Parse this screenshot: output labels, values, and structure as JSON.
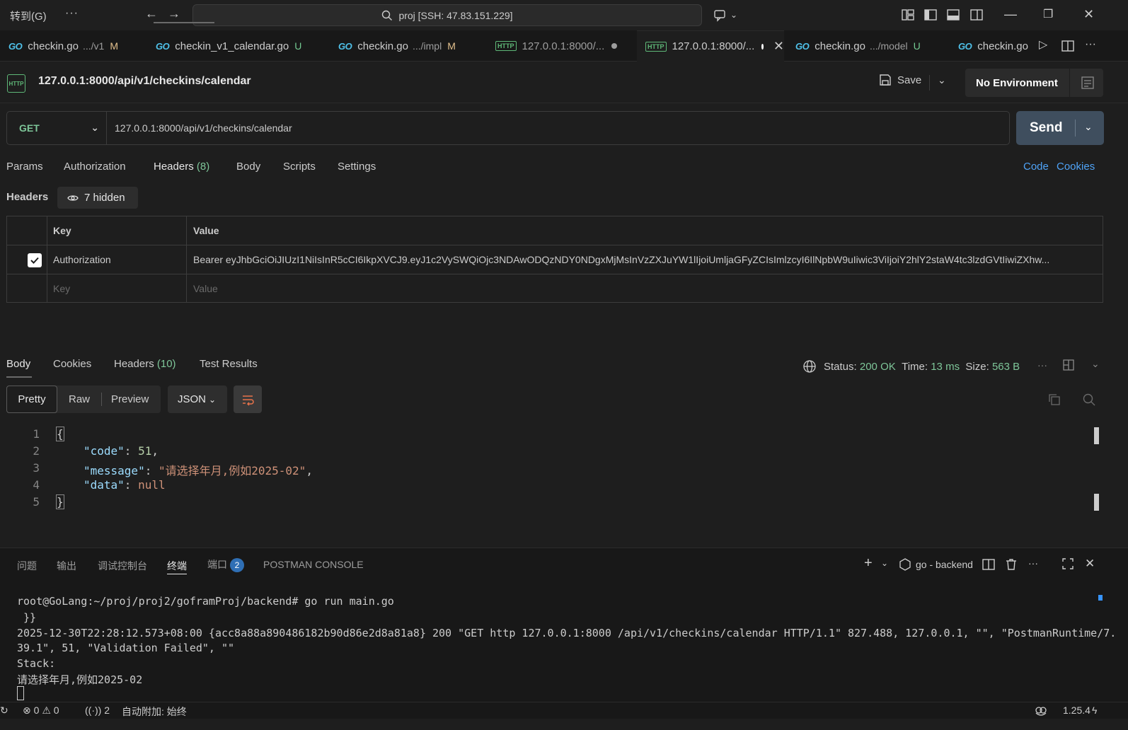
{
  "titlebar": {
    "goto_menu": "转到(G)",
    "more": "···",
    "search_text": "proj [SSH: 47.83.151.229]"
  },
  "tabs": [
    {
      "label": "checkin.go",
      "sub": ".../v1",
      "status": "M"
    },
    {
      "label": "checkin_v1_calendar.go",
      "sub": "",
      "status": "U"
    },
    {
      "label": "checkin.go",
      "sub": ".../impl",
      "status": "M"
    },
    {
      "label": "127.0.0.1:8000/...",
      "sub": "",
      "status": ""
    },
    {
      "label": "127.0.0.1:8000/...",
      "sub": "",
      "status": ""
    },
    {
      "label": "checkin.go",
      "sub": ".../model",
      "status": "U"
    },
    {
      "label": "checkin.go",
      "sub": "",
      "status": ""
    }
  ],
  "request": {
    "title": "127.0.0.1:8000/api/v1/checkins/calendar",
    "save_label": "Save",
    "environment": "No Environment",
    "method": "GET",
    "url": "127.0.0.1:8000/api/v1/checkins/calendar",
    "send_label": "Send"
  },
  "request_tabs": {
    "params": "Params",
    "authorization": "Authorization",
    "headers": "Headers",
    "headers_count": "(8)",
    "body": "Body",
    "scripts": "Scripts",
    "settings": "Settings",
    "code_link": "Code",
    "cookies_link": "Cookies"
  },
  "headers_section": {
    "label": "Headers",
    "hidden_label": "7 hidden",
    "col_key": "Key",
    "col_value": "Value",
    "rows": [
      {
        "key": "Authorization",
        "value": "Bearer eyJhbGciOiJIUzI1NiIsInR5cCI6IkpXVCJ9.eyJ1c2VySWQiOjc3NDAwODQzNDY0NDgxMjMsInVzZXJuYW1lIjoiUmljaGFyZCIsImlzcyI6IlNpbW9uIiwic3ViIjoiY2hlY2staW4tc3lzdGVtIiwiZXhw..."
      }
    ],
    "key_placeholder": "Key",
    "value_placeholder": "Value"
  },
  "response": {
    "tabs": {
      "body": "Body",
      "cookies": "Cookies",
      "headers": "Headers",
      "headers_count": "(10)",
      "test_results": "Test Results"
    },
    "status_label": "Status:",
    "status_value": "200 OK",
    "time_label": "Time:",
    "time_value": "13 ms",
    "size_label": "Size:",
    "size_value": "563 B",
    "formats": {
      "pretty": "Pretty",
      "raw": "Raw",
      "preview": "Preview",
      "json": "JSON"
    },
    "body_lines": [
      {
        "n": "1"
      },
      {
        "n": "2",
        "key": "\"code\"",
        "val": "51"
      },
      {
        "n": "3",
        "key": "\"message\"",
        "val": "\"请选择年月,例如2025-02\""
      },
      {
        "n": "4",
        "key": "\"data\"",
        "val": "null"
      },
      {
        "n": "5"
      }
    ],
    "open_brace": "{",
    "close_brace": "}"
  },
  "panel": {
    "tabs": {
      "problems": "问题",
      "output": "输出",
      "debug_console": "调试控制台",
      "terminal": "终端",
      "ports": "端口",
      "ports_count": "2",
      "postman_console": "POSTMAN CONSOLE"
    },
    "terminal_name": "go - backend",
    "terminal_lines": [
      "root@GoLang:~/proj/proj2/goframProj/backend# go run main.go",
      " }}",
      "2025-12-30T22:28:12.573+08:00 {acc8a88a890486182b90d86e2d8a81a8} 200 \"GET http 127.0.0.1:8000 /api/v1/checkins/calendar HTTP/1.1\" 827.488, 127.0.0.1, \"\", \"PostmanRuntime/7.",
      "39.1\", 51, \"Validation Failed\", \"\"",
      "Stack:",
      "请选择年月,例如2025-02"
    ]
  },
  "statusbar": {
    "errors": "0",
    "warnings": "0",
    "ports": "2",
    "auto_attach": "自动附加: 始终",
    "go_version": "1.25.4"
  }
}
